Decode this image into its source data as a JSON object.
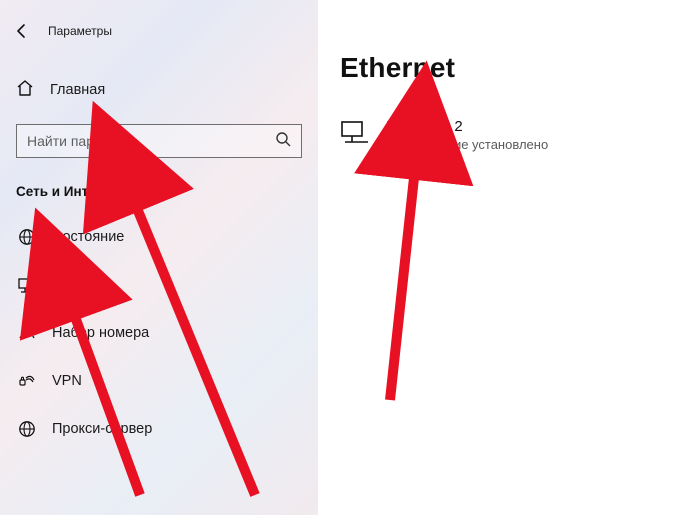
{
  "header": {
    "title": "Параметры"
  },
  "home_label": "Главная",
  "search": {
    "placeholder": "Найти параметр"
  },
  "section_header": "Сеть и Интернет",
  "nav_items": [
    {
      "label": "Состояние"
    },
    {
      "label": "Ethernet"
    },
    {
      "label": "Набор номера"
    },
    {
      "label": "VPN"
    },
    {
      "label": "Прокси-сервер"
    }
  ],
  "main": {
    "heading": "Ethernet",
    "connection": {
      "name": "PGPlm69 2",
      "status": "Подключение установлено"
    }
  }
}
